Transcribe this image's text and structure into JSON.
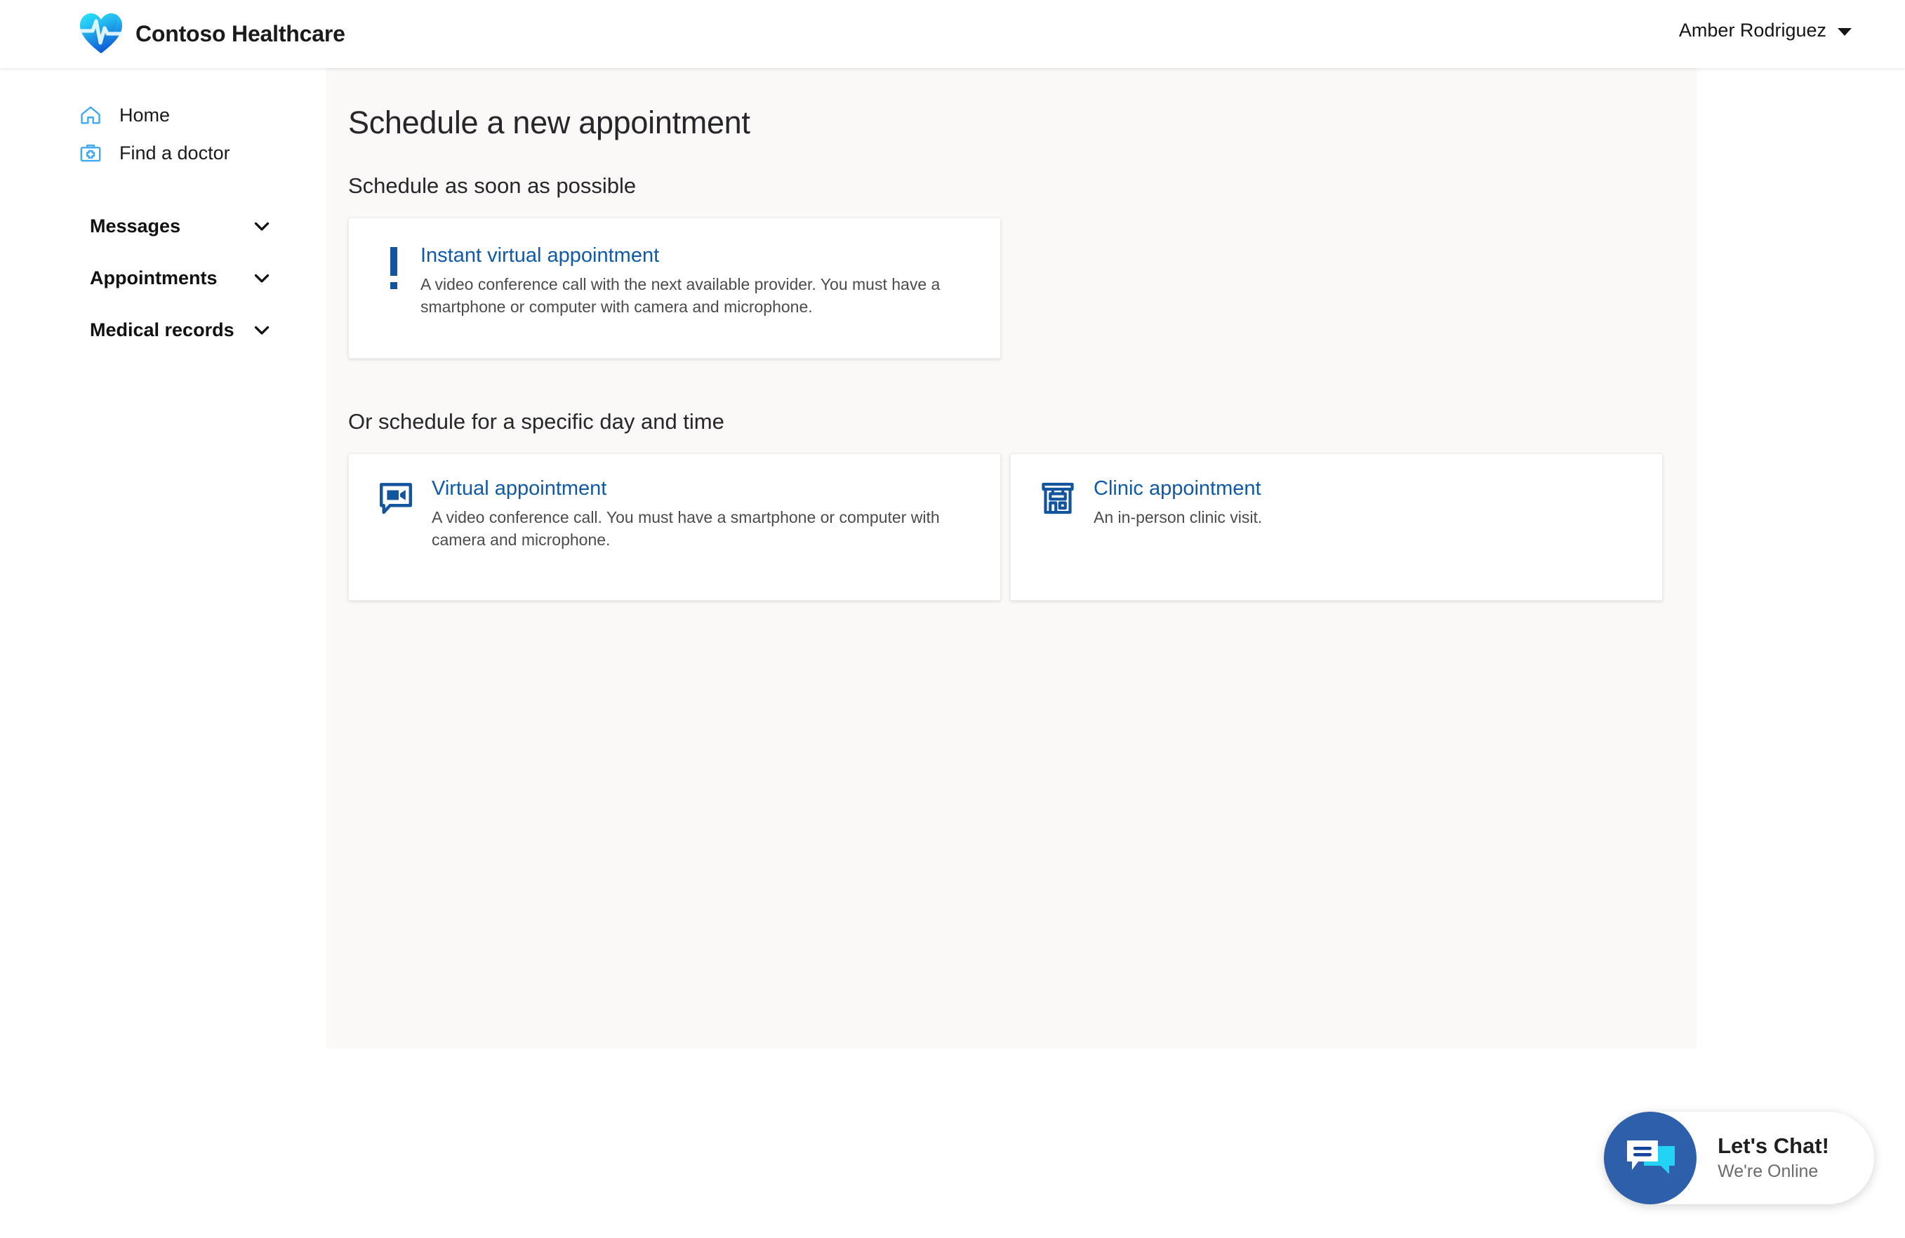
{
  "header": {
    "brand_name": "Contoso Healthcare",
    "logo_icon": "heart-pulse-logo",
    "user_name": "Amber Rodriguez",
    "caret_icon": "chevron-down-icon"
  },
  "sidebar": {
    "links": [
      {
        "label": "Home",
        "icon": "home-icon"
      },
      {
        "label": "Find a doctor",
        "icon": "medical-bag-icon"
      }
    ],
    "sections": [
      {
        "label": "Messages",
        "icon": "chevron-down-icon"
      },
      {
        "label": "Appointments",
        "icon": "chevron-down-icon"
      },
      {
        "label": "Medical records",
        "icon": "chevron-down-icon"
      }
    ]
  },
  "main": {
    "page_title": "Schedule a new appointment",
    "section_asap": {
      "title": "Schedule as soon as possible",
      "cards": [
        {
          "title": "Instant virtual appointment",
          "desc": "A video conference call with the next available provider. You must have a smartphone or computer with camera and microphone.",
          "icon": "exclamation-icon"
        }
      ]
    },
    "section_scheduled": {
      "title": "Or schedule for a specific day and time",
      "cards": [
        {
          "title": "Virtual appointment",
          "desc": "A video conference call. You must have a smartphone or computer with camera and microphone.",
          "icon": "video-chat-icon"
        },
        {
          "title": "Clinic appointment",
          "desc": "An in-person clinic visit.",
          "icon": "clinic-building-icon"
        }
      ]
    }
  },
  "chat": {
    "title": "Let's Chat!",
    "status": "We're Online",
    "icon": "chat-bubbles-icon"
  },
  "colors": {
    "link_blue": "#0f5aa8",
    "icon_blue": "#3fa9f5",
    "chat_circle": "#2e5faa",
    "chat_accent_cyan": "#22d3f5",
    "content_bg": "#faf9f7",
    "text_primary": "#26262b"
  }
}
